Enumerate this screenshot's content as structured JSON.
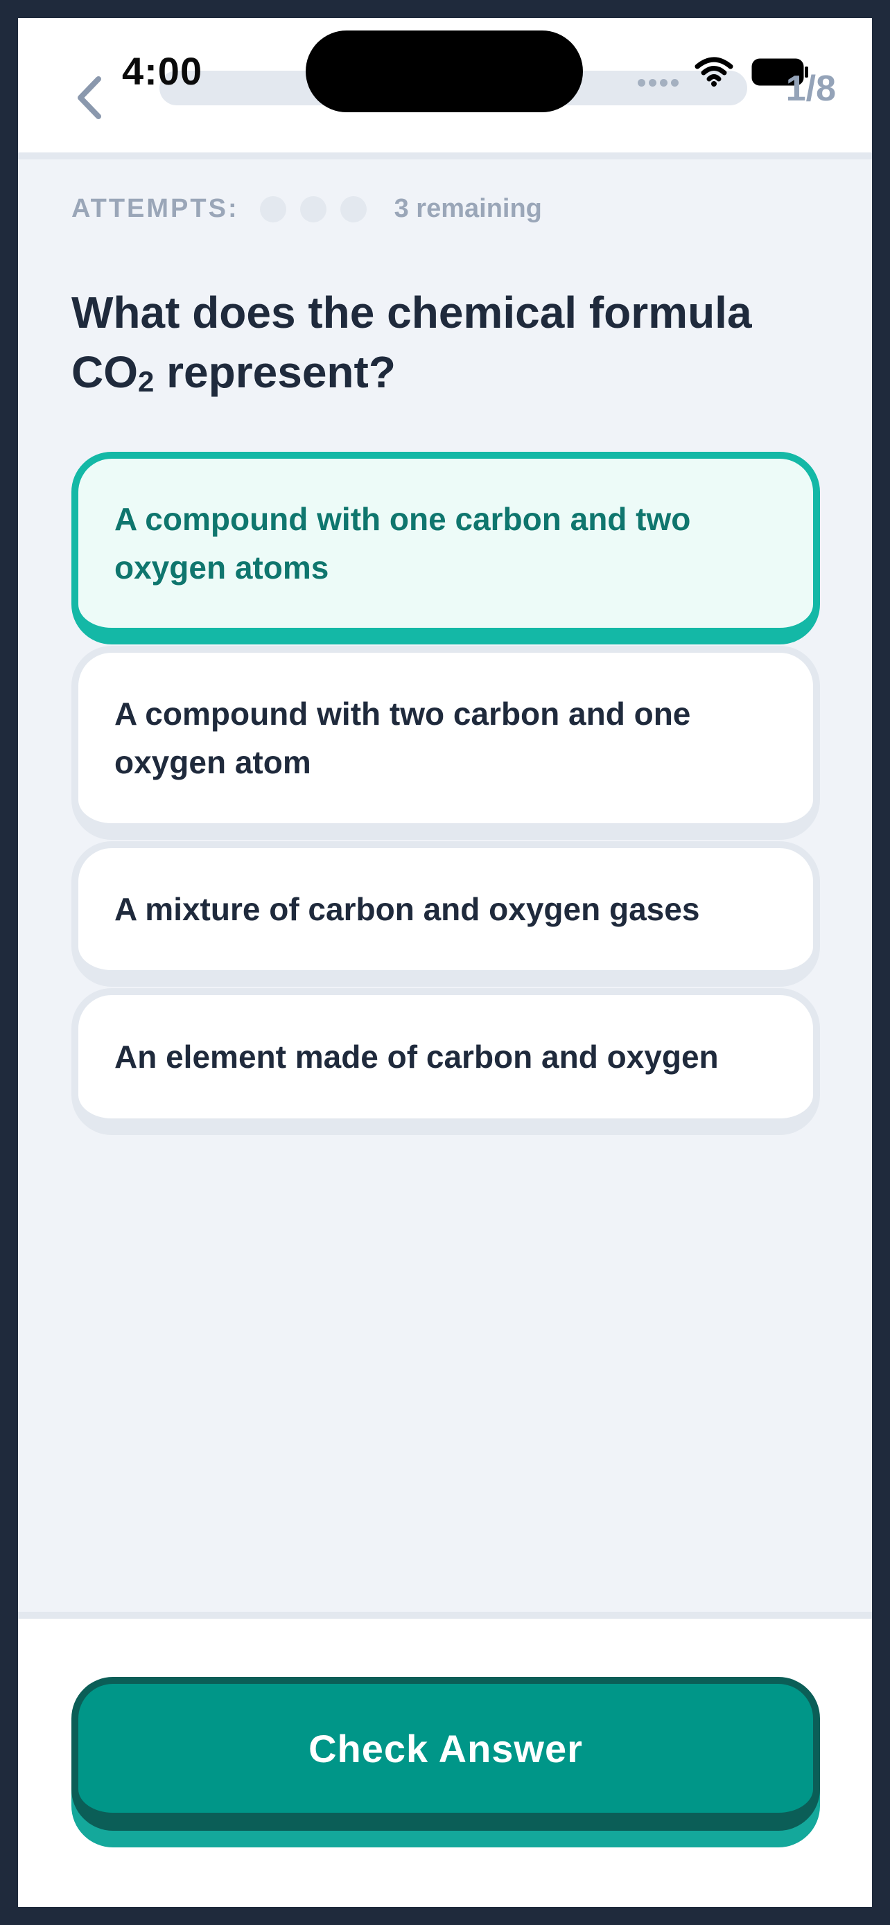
{
  "status_bar": {
    "time": "4:00",
    "icons": [
      "wifi-icon",
      "battery-icon"
    ]
  },
  "header": {
    "back_icon": "chevron-left-icon",
    "counter": "1/8"
  },
  "attempts": {
    "label": "ATTEMPTS:",
    "remaining_text": "3 remaining",
    "remaining_count": 3
  },
  "question": {
    "text_before": "What does the chemical formula CO",
    "subscript": "2",
    "text_after": " represent?"
  },
  "options": [
    {
      "label": "A compound with one carbon and two oxygen atoms",
      "selected": true
    },
    {
      "label": "A compound with two carbon and one oxygen atom",
      "selected": false
    },
    {
      "label": "A mixture of carbon and oxygen gases",
      "selected": false
    },
    {
      "label": "An element made of carbon and oxygen",
      "selected": false
    }
  ],
  "footer": {
    "check_label": "Check Answer"
  },
  "colors": {
    "accent": "#14b8a6",
    "button": "#009688",
    "text": "#1f2a3c",
    "muted": "#94a3b8"
  }
}
